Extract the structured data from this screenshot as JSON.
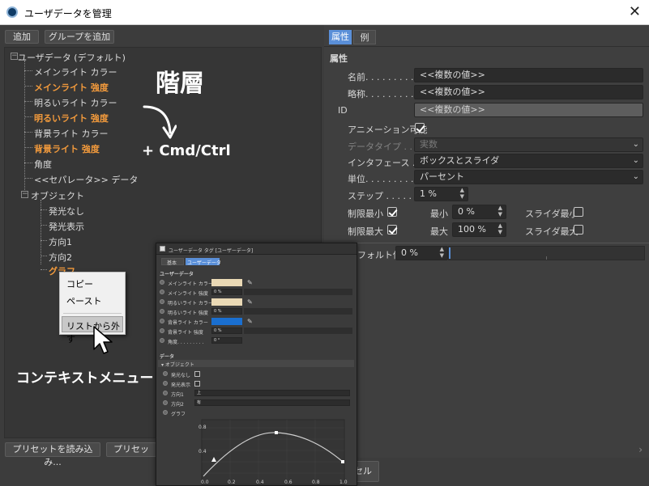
{
  "window": {
    "title": "ユーザデータを管理",
    "close": "✕"
  },
  "toolbar": {
    "add": "追加",
    "add_group": "グループを追加"
  },
  "tree": {
    "root": "ユーザデータ (デフォルト)",
    "items": [
      "メインライト カラー",
      "メインライト 強度",
      "明るいライト カラー",
      "明るいライト 強度",
      "背景ライト カラー",
      "背景ライト 強度",
      "角度",
      "<<セパレータ>> データ"
    ],
    "group": "オブジェクト",
    "group_items": [
      "発光なし",
      "発光表示",
      "方向1",
      "方向2",
      "グラフ"
    ]
  },
  "context_menu": {
    "copy": "コピー",
    "paste": "ペースト",
    "remove": "リストから外す"
  },
  "annotations": {
    "hierarchy": "階層",
    "shortcut": "+ Cmd/Ctrl",
    "context": "コンテキストメニュー",
    "attributes": "属性"
  },
  "right": {
    "tabs": [
      "属性",
      "例"
    ],
    "section": "属性",
    "name_label": "名前. . . . . . . . .",
    "name_value": "<<複数の値>>",
    "short_label": "略称. . . . . . . . .",
    "short_value": "<<複数の値>>",
    "id_label": "ID",
    "id_value": "<<複数の値>>",
    "anim_label": "アニメーション可能",
    "dtype_label": "データタイプ . . . .",
    "dtype_value": "実数",
    "iface_label": "インタフェース . . .",
    "iface_value": "ボックスとスライダ",
    "unit_label": "単位. . . . . . . . .",
    "unit_value": "パーセント",
    "step_label": "ステップ . . . . . .",
    "step_value": "1 %",
    "minlim_label": "制限最小",
    "min_label": "最小",
    "min_value": "0 %",
    "sliderminlabel": "スライダ最小",
    "maxlim_label": "制限最大",
    "max_label": "最大",
    "max_value": "100 %",
    "slidermaxlabel": "スライダ最大",
    "default_label": "フォルト値",
    "default_value": "0 %"
  },
  "bottom": {
    "load_preset": "プリセットを読み込み...",
    "save_preset": "プリセットを保",
    "cancel": "セル"
  },
  "inset": {
    "title": "ユーザーデータ タグ [ユーザーデータ]",
    "tab_basic": "基本",
    "tab_user": "ユーザーデータ",
    "section": "ユーザーデータ",
    "rows": [
      {
        "label": "メインライト カラー",
        "value": ""
      },
      {
        "label": "メインライト 強度",
        "value": "0 %"
      },
      {
        "label": "明るいライト カラー",
        "value": ""
      },
      {
        "label": "明るいライト 強度",
        "value": "0 %"
      },
      {
        "label": "背景ライト カラー",
        "value": ""
      },
      {
        "label": "背景ライト 強度",
        "value": "0 %"
      },
      {
        "label": "角度. . . . . . . . .",
        "value": "0 °"
      }
    ],
    "data_section": "データ",
    "object_section": "▾ オブジェクト",
    "obj_rows": [
      "発光なし",
      "発光表示",
      "方向1",
      "方向2",
      "グラフ"
    ],
    "dir1_value": "上",
    "dir2_value": "有",
    "graph_y": [
      "0.8",
      "0.4"
    ],
    "graph_x": [
      "0.0",
      "0.2",
      "0.4",
      "0.6",
      "0.8",
      "1.0"
    ]
  },
  "colors": {
    "orange": "#f29a3c",
    "swatch_cream": "#ead9b5",
    "swatch_blue": "#1a6fd0",
    "tab_active": "#5a8fd8"
  }
}
